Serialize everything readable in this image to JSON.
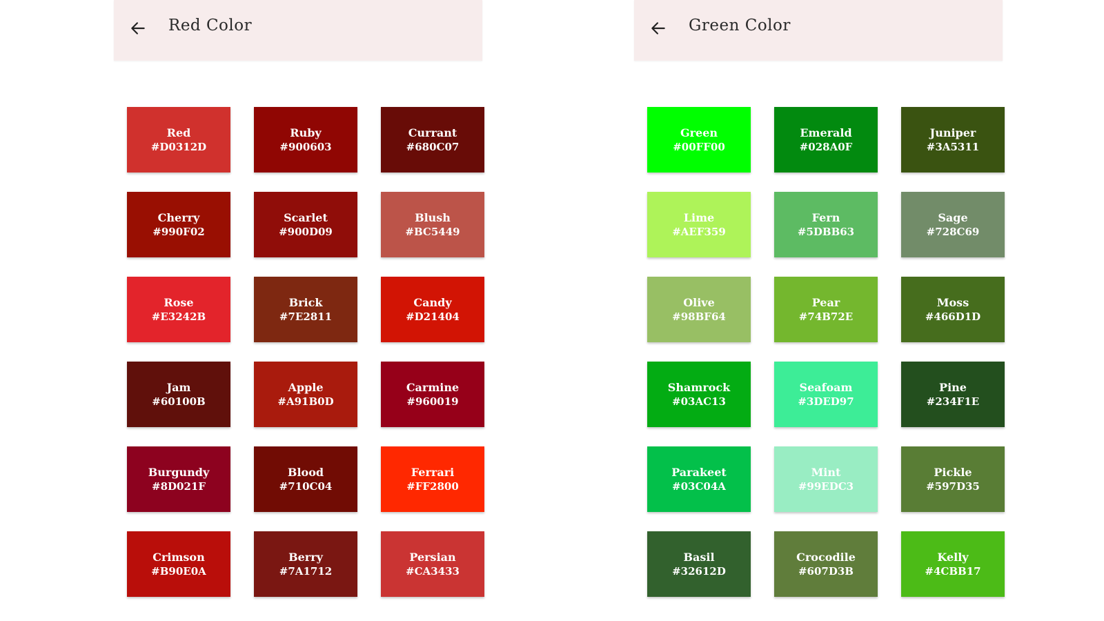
{
  "screens": [
    {
      "title": "Red Color",
      "back_icon": "arrow-left-icon",
      "colors": [
        {
          "name": "Red",
          "hex": "#D0312D"
        },
        {
          "name": "Ruby",
          "hex": "#900603"
        },
        {
          "name": "Currant",
          "hex": "#680C07"
        },
        {
          "name": "Cherry",
          "hex": "#990F02"
        },
        {
          "name": "Scarlet",
          "hex": "#900D09"
        },
        {
          "name": "Blush",
          "hex": "#BC5449"
        },
        {
          "name": "Rose",
          "hex": "#E3242B"
        },
        {
          "name": "Brick",
          "hex": "#7E2811"
        },
        {
          "name": "Candy",
          "hex": "#D21404"
        },
        {
          "name": "Jam",
          "hex": "#60100B"
        },
        {
          "name": "Apple",
          "hex": "#A91B0D"
        },
        {
          "name": "Carmine",
          "hex": "#960019"
        },
        {
          "name": "Burgundy",
          "hex": "#8D021F"
        },
        {
          "name": "Blood",
          "hex": "#710C04"
        },
        {
          "name": "Ferrari",
          "hex": "#FF2800"
        },
        {
          "name": "Crimson",
          "hex": "#B90E0A"
        },
        {
          "name": "Berry",
          "hex": "#7A1712"
        },
        {
          "name": "Persian",
          "hex": "#CA3433"
        }
      ]
    },
    {
      "title": "Green Color",
      "back_icon": "arrow-left-icon",
      "colors": [
        {
          "name": "Green",
          "hex": "#00FF00"
        },
        {
          "name": "Emerald",
          "hex": "#028A0F"
        },
        {
          "name": "Juniper",
          "hex": "#3A5311"
        },
        {
          "name": "Lime",
          "hex": "#AEF359"
        },
        {
          "name": "Fern",
          "hex": "#5DBB63"
        },
        {
          "name": "Sage",
          "hex": "#728C69"
        },
        {
          "name": "Olive",
          "hex": "#98BF64"
        },
        {
          "name": "Pear",
          "hex": "#74B72E"
        },
        {
          "name": "Moss",
          "hex": "#466D1D"
        },
        {
          "name": "Shamrock",
          "hex": "#03AC13"
        },
        {
          "name": "Seafoam",
          "hex": "#3DED97"
        },
        {
          "name": "Pine",
          "hex": "#234F1E"
        },
        {
          "name": "Parakeet",
          "hex": "#03C04A"
        },
        {
          "name": "Mint",
          "hex": "#99EDC3"
        },
        {
          "name": "Pickle",
          "hex": "#597D35"
        },
        {
          "name": "Basil",
          "hex": "#32612D"
        },
        {
          "name": "Crocodile",
          "hex": "#607D3B"
        },
        {
          "name": "Kelly",
          "hex": "#4CBB17"
        }
      ]
    }
  ],
  "colors": {
    "appbar_background": "#f7ecec",
    "title_text": "#2a2a2a",
    "swatch_text": "#ffffff"
  }
}
